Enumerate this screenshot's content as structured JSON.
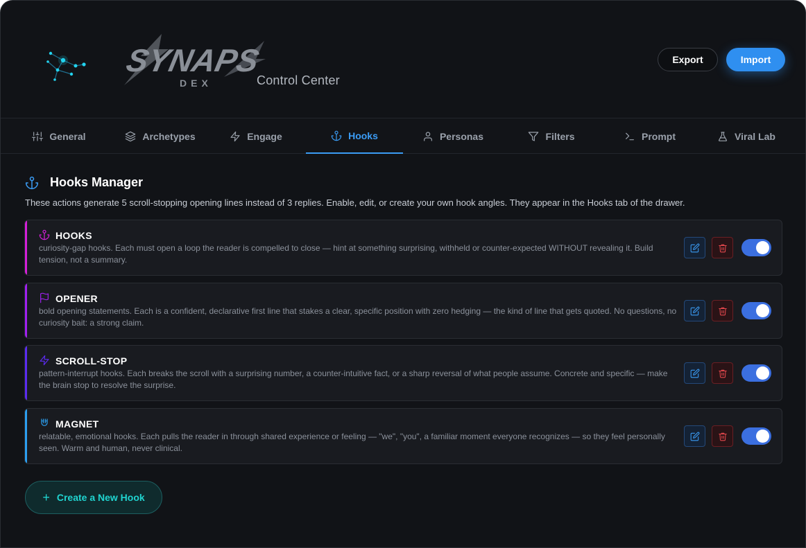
{
  "header": {
    "logo_text": "SYNAPS",
    "logo_sub": "DEX",
    "subtitle": "Control Center",
    "export_label": "Export",
    "import_label": "Import"
  },
  "tabs": [
    {
      "label": "General",
      "icon": "sliders-icon"
    },
    {
      "label": "Archetypes",
      "icon": "layers-icon"
    },
    {
      "label": "Engage",
      "icon": "zap-icon"
    },
    {
      "label": "Hooks",
      "icon": "anchor-icon",
      "active": true
    },
    {
      "label": "Personas",
      "icon": "user-icon"
    },
    {
      "label": "Filters",
      "icon": "filter-icon"
    },
    {
      "label": "Prompt",
      "icon": "terminal-icon"
    },
    {
      "label": "Viral Lab",
      "icon": "flask-icon"
    }
  ],
  "main": {
    "title": "Hooks Manager",
    "description": "These actions generate 5 scroll-stopping opening lines instead of 3 replies. Enable, edit, or create your own hook angles. They appear in the Hooks tab of the drawer.",
    "hooks": [
      {
        "name": "HOOKS",
        "icon": "anchor-icon",
        "accent": "#d41fd8",
        "enabled": true,
        "description": "curiosity-gap hooks. Each must open a loop the reader is compelled to close — hint at something surprising, withheld or counter-expected WITHOUT revealing it. Build tension, not a summary."
      },
      {
        "name": "OPENER",
        "icon": "flag-icon",
        "accent": "#a020f0",
        "enabled": true,
        "description": "bold opening statements. Each is a confident, declarative first line that stakes a clear, specific position with zero hedging — the kind of line that gets quoted. No questions, no curiosity bait: a strong claim."
      },
      {
        "name": "SCROLL-STOP",
        "icon": "zap-icon",
        "accent": "#5b2bf0",
        "enabled": true,
        "description": "pattern-interrupt hooks. Each breaks the scroll with a surprising number, a counter-intuitive fact, or a sharp reversal of what people assume. Concrete and specific — make the brain stop to resolve the surprise."
      },
      {
        "name": "MAGNET",
        "icon": "magnet-icon",
        "accent": "#2b9ff0",
        "enabled": true,
        "description": "relatable, emotional hooks. Each pulls the reader in through shared experience or feeling — \"we\", \"you\", a familiar moment everyone recognizes — so they feel personally seen. Warm and human, never clinical."
      }
    ],
    "create_label": "Create a New Hook"
  },
  "colors": {
    "accent_blue": "#3b9cf5",
    "import_bg": "#2f8ff0",
    "create_text": "#20d4d0",
    "delete_red": "#e5484d"
  }
}
